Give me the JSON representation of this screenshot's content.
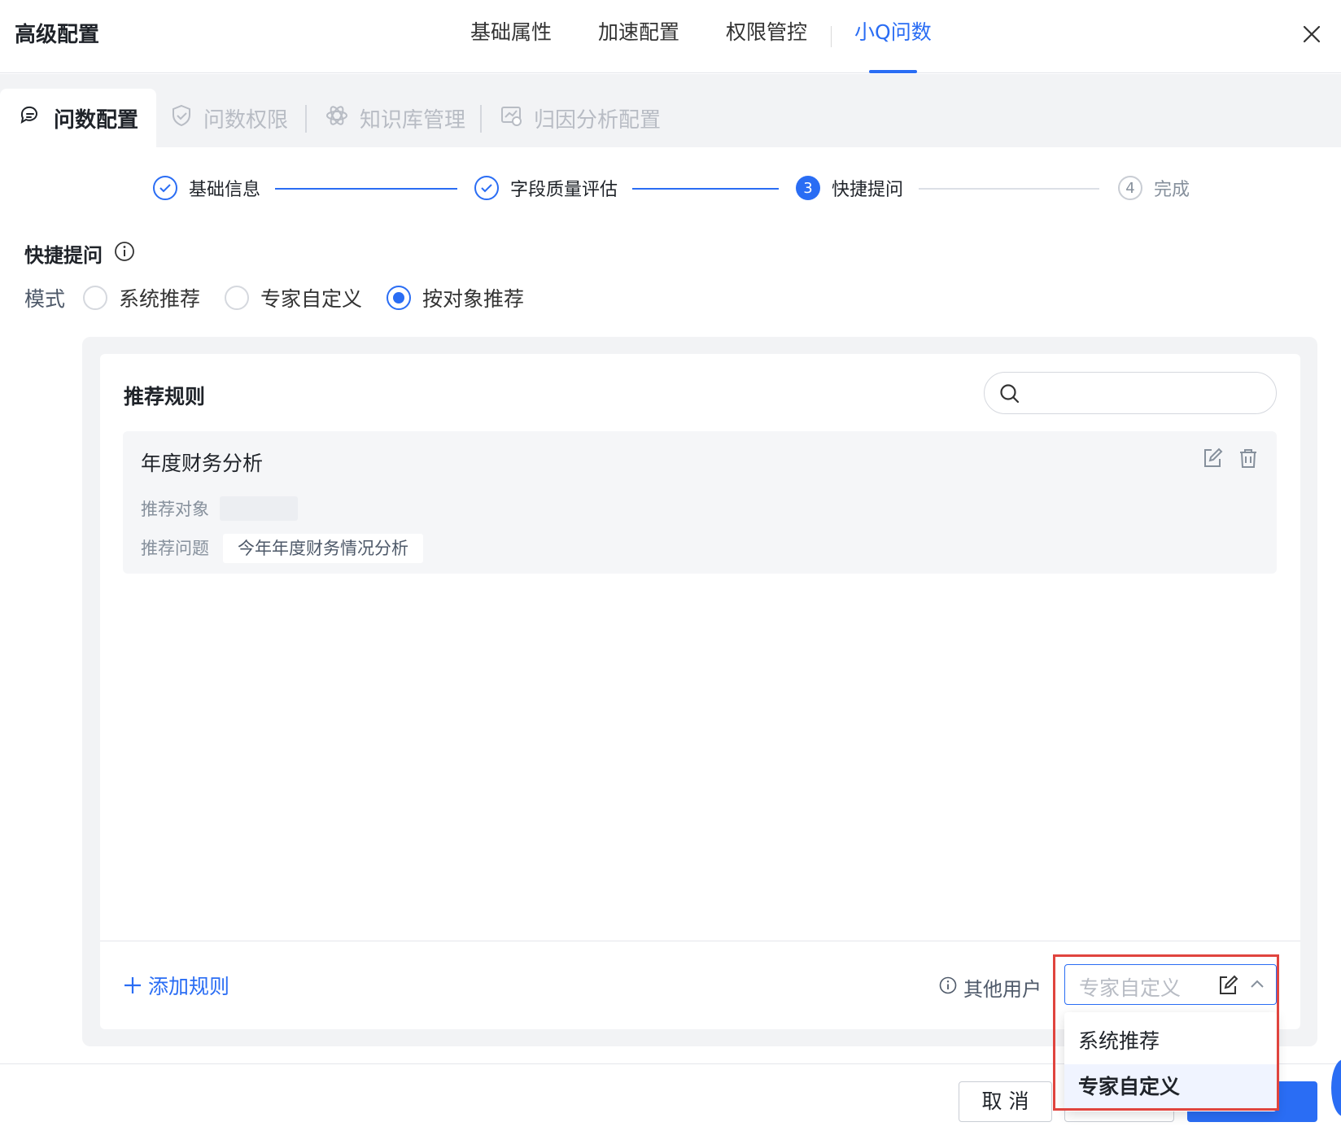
{
  "header": {
    "title": "高级配置",
    "tabs": [
      {
        "label": "基础属性"
      },
      {
        "label": "加速配置"
      },
      {
        "label": "权限管控"
      },
      {
        "label": "小Q问数",
        "active": true
      }
    ]
  },
  "subtabs": [
    {
      "label": "问数配置",
      "icon": "chat-icon",
      "active": true
    },
    {
      "label": "问数权限",
      "icon": "shield-icon"
    },
    {
      "label": "知识库管理",
      "icon": "atom-icon"
    },
    {
      "label": "归因分析配置",
      "icon": "analysis-icon"
    }
  ],
  "steps": [
    {
      "label": "基础信息",
      "status": "done"
    },
    {
      "label": "字段质量评估",
      "status": "done"
    },
    {
      "label": "快捷提问",
      "status": "current",
      "number": "3"
    },
    {
      "label": "完成",
      "status": "todo",
      "number": "4"
    }
  ],
  "quick_ask": {
    "title": "快捷提问",
    "mode_label": "模式",
    "modes": [
      {
        "label": "系统推荐",
        "checked": false
      },
      {
        "label": "专家自定义",
        "checked": false
      },
      {
        "label": "按对象推荐",
        "checked": true
      }
    ]
  },
  "rules": {
    "title": "推荐规则",
    "search_placeholder": "",
    "items": [
      {
        "name": "年度财务分析",
        "object_label": "推荐对象",
        "question_label": "推荐问题",
        "question": "今年年度财务情况分析"
      }
    ],
    "add_label": "添加规则",
    "other_users_label": "其他用户",
    "select_value": "专家自定义",
    "dropdown_options": [
      {
        "label": "系统推荐"
      },
      {
        "label": "专家自定义",
        "selected": true
      }
    ]
  },
  "footer": {
    "cancel_label": "取 消"
  },
  "colors": {
    "accent": "#2a6df4",
    "highlight": "#e0443e"
  }
}
